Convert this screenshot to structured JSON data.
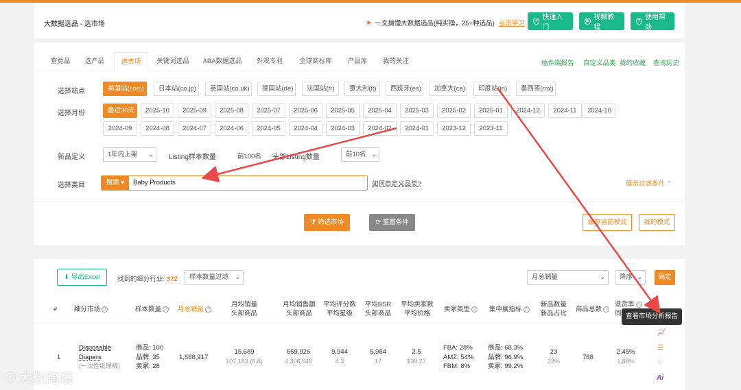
{
  "header": {
    "title": "大数据选品 - 选市场",
    "announce": "一文搞懂大数据选品(纯实操，25+种选品)",
    "learn_link": "点击学习",
    "buttons": [
      "快速入门",
      "视频教程",
      "使用帮助"
    ]
  },
  "tabs": [
    "查竞品",
    "选产品",
    "选市场",
    "关键词选品",
    "ABA数据选品",
    "外观专利",
    "全球商标库",
    "产品库",
    "我的关注"
  ],
  "right_links": [
    "插件端报告",
    "自定义品类",
    "我的收藏",
    "查询历史"
  ],
  "site": {
    "label": "选择站点",
    "options": [
      "美国站(com)",
      "日本站(co.jp)",
      "英国站(co.uk)",
      "德国站(de)",
      "法国站(fr)",
      "意大利(it)",
      "西班牙(es)",
      "加拿大(ca)",
      "印度站(in)",
      "墨西哥(mx)"
    ]
  },
  "month": {
    "label": "选择月份",
    "row1": [
      "最近30天",
      "2025-10",
      "2025-09",
      "2025-08",
      "2025-07",
      "2025-06",
      "2025-05",
      "2025-04",
      "2025-03",
      "2025-02",
      "2025-01",
      "2024-12",
      "2024-11",
      "2024-10"
    ],
    "row2": [
      "2024-09",
      "2024-08",
      "2024-07",
      "2024-06",
      "2024-05",
      "2024-04",
      "2024-03",
      "2024-02",
      "2024-01",
      "2023-12",
      "2023-11"
    ]
  },
  "newdef": {
    "label": "新品定义",
    "value": "1年内上架",
    "listing_label": "Listing样本数量",
    "listing_value": "前100名",
    "head_label": "头部Listing数量",
    "head_value": "前10名"
  },
  "category": {
    "label": "选择类目",
    "type": "搜索",
    "value": "Baby Products",
    "howto": "如何自定义品类?",
    "show_filter": "展示过滤条件"
  },
  "actions": {
    "filter": "筛选市场",
    "reset": "重置条件",
    "save": "保存当前模式",
    "mine": "我的模式"
  },
  "results": {
    "export": "导出Excel",
    "found_label": "找到的细分行业:",
    "found_count": "372",
    "sample_filter": "样本数量过滤",
    "sort_field": "月总销量",
    "sort_order": "降序",
    "confirm": "确定"
  },
  "columns": [
    {
      "l1": "#",
      "l2": ""
    },
    {
      "l1": "细分市场",
      "l2": ""
    },
    {
      "l1": "样本数量",
      "l2": ""
    },
    {
      "l1": "月总销量",
      "l2": ""
    },
    {
      "l1": "月均销量",
      "l2": "头部商品"
    },
    {
      "l1": "月均销售额",
      "l2": "头部商品"
    },
    {
      "l1": "平均评分数",
      "l2": "平均星级"
    },
    {
      "l1": "平均BSR",
      "l2": "头部商品"
    },
    {
      "l1": "平均卖家数",
      "l2": "平均价格"
    },
    {
      "l1": "卖家类型",
      "l2": ""
    },
    {
      "l1": "集中度指标",
      "l2": ""
    },
    {
      "l1": "新品数量",
      "l2": "新品占比"
    },
    {
      "l1": "商品总数",
      "l2": ""
    },
    {
      "l1": "退货率",
      "l2": "同"
    }
  ],
  "row": {
    "idx": "1",
    "market": "Disposable Diapers",
    "market_sub": "(一次性纸尿裤)",
    "sample": [
      "商品: 100",
      "品牌: 35",
      "卖家: 28"
    ],
    "total_sales": "1,568,917",
    "avg_sales": "15,689",
    "avg_sales_sub": "107,183 (6.8)",
    "avg_revenue": "659,926",
    "avg_revenue_sub": "4,306,646",
    "avg_reviews": "9,944",
    "avg_rating": "4.3",
    "avg_bsr": "5,984",
    "avg_bsr_sub": "17",
    "avg_sellers": "2.5",
    "avg_price": "$39.27",
    "seller_type": [
      "FBA: 28%",
      "AMZ: 54%",
      "FBM: 8%"
    ],
    "concentration": [
      "商品: 68.3%",
      "品牌: 96.9%",
      "卖家: 99.2%"
    ],
    "new_count": "23",
    "new_ratio": "23%",
    "total_products": "788",
    "return_rate": "2.45%",
    "return_sub": "1.88%"
  },
  "tooltip": "查看市场分析报告",
  "watermark": "大数跨境"
}
